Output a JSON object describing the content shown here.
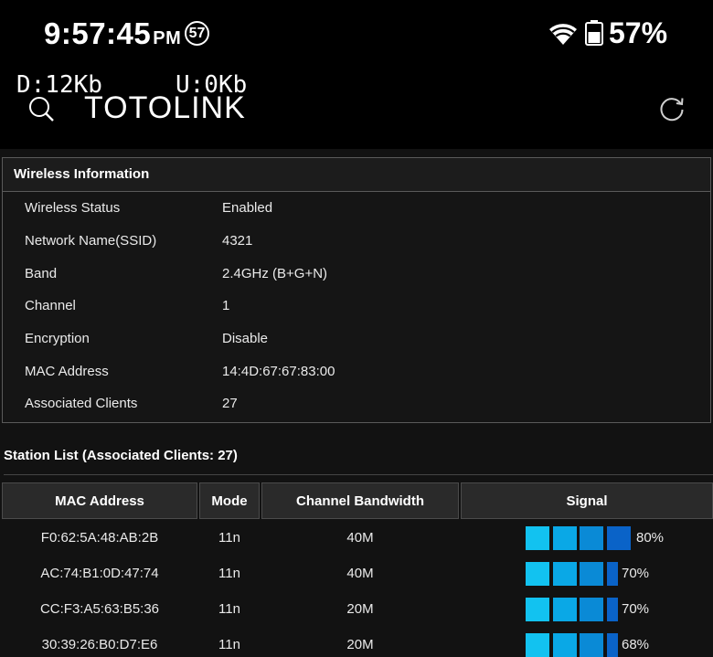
{
  "status_bar": {
    "time": "9:57:45",
    "ampm": "PM",
    "notification_count": "57",
    "battery_percent": "57%"
  },
  "header": {
    "download": "D:12Kb",
    "upload": "U:0Kb",
    "brand": "TOTOLINK"
  },
  "wireless": {
    "title": "Wireless Information",
    "rows": [
      {
        "label": "Wireless Status",
        "value": "Enabled"
      },
      {
        "label": "Network Name(SSID)",
        "value": "4321"
      },
      {
        "label": "Band",
        "value": "2.4GHz (B+G+N)"
      },
      {
        "label": "Channel",
        "value": "1"
      },
      {
        "label": "Encryption",
        "value": "Disable"
      },
      {
        "label": "MAC Address",
        "value": "14:4D:67:67:83:00"
      },
      {
        "label": "Associated Clients",
        "value": "27"
      }
    ]
  },
  "station_list": {
    "title": "Station List (Associated Clients: 27)",
    "columns": [
      "MAC Address",
      "Mode",
      "Channel Bandwidth",
      "Signal"
    ],
    "rows": [
      {
        "mac": "F0:62:5A:48:AB:2B",
        "mode": "11n",
        "bandwidth": "40M",
        "signal": "80%",
        "signal_level": 0.8
      },
      {
        "mac": "AC:74:B1:0D:47:74",
        "mode": "11n",
        "bandwidth": "40M",
        "signal": "70%",
        "signal_level": 0.7
      },
      {
        "mac": "CC:F3:A5:63:B5:36",
        "mode": "11n",
        "bandwidth": "20M",
        "signal": "70%",
        "signal_level": 0.7
      },
      {
        "mac": "30:39:26:B0:D7:E6",
        "mode": "11n",
        "bandwidth": "20M",
        "signal": "68%",
        "signal_level": 0.68
      }
    ]
  },
  "colors": {
    "signal_bars": [
      "#12c2f0",
      "#0aa8e6",
      "#0a8ad6",
      "#0a63c8"
    ],
    "background": "#121212",
    "header_background": "#000000"
  },
  "icons": [
    "wifi-icon",
    "battery-icon",
    "search-icon",
    "refresh-icon",
    "notification-badge"
  ]
}
